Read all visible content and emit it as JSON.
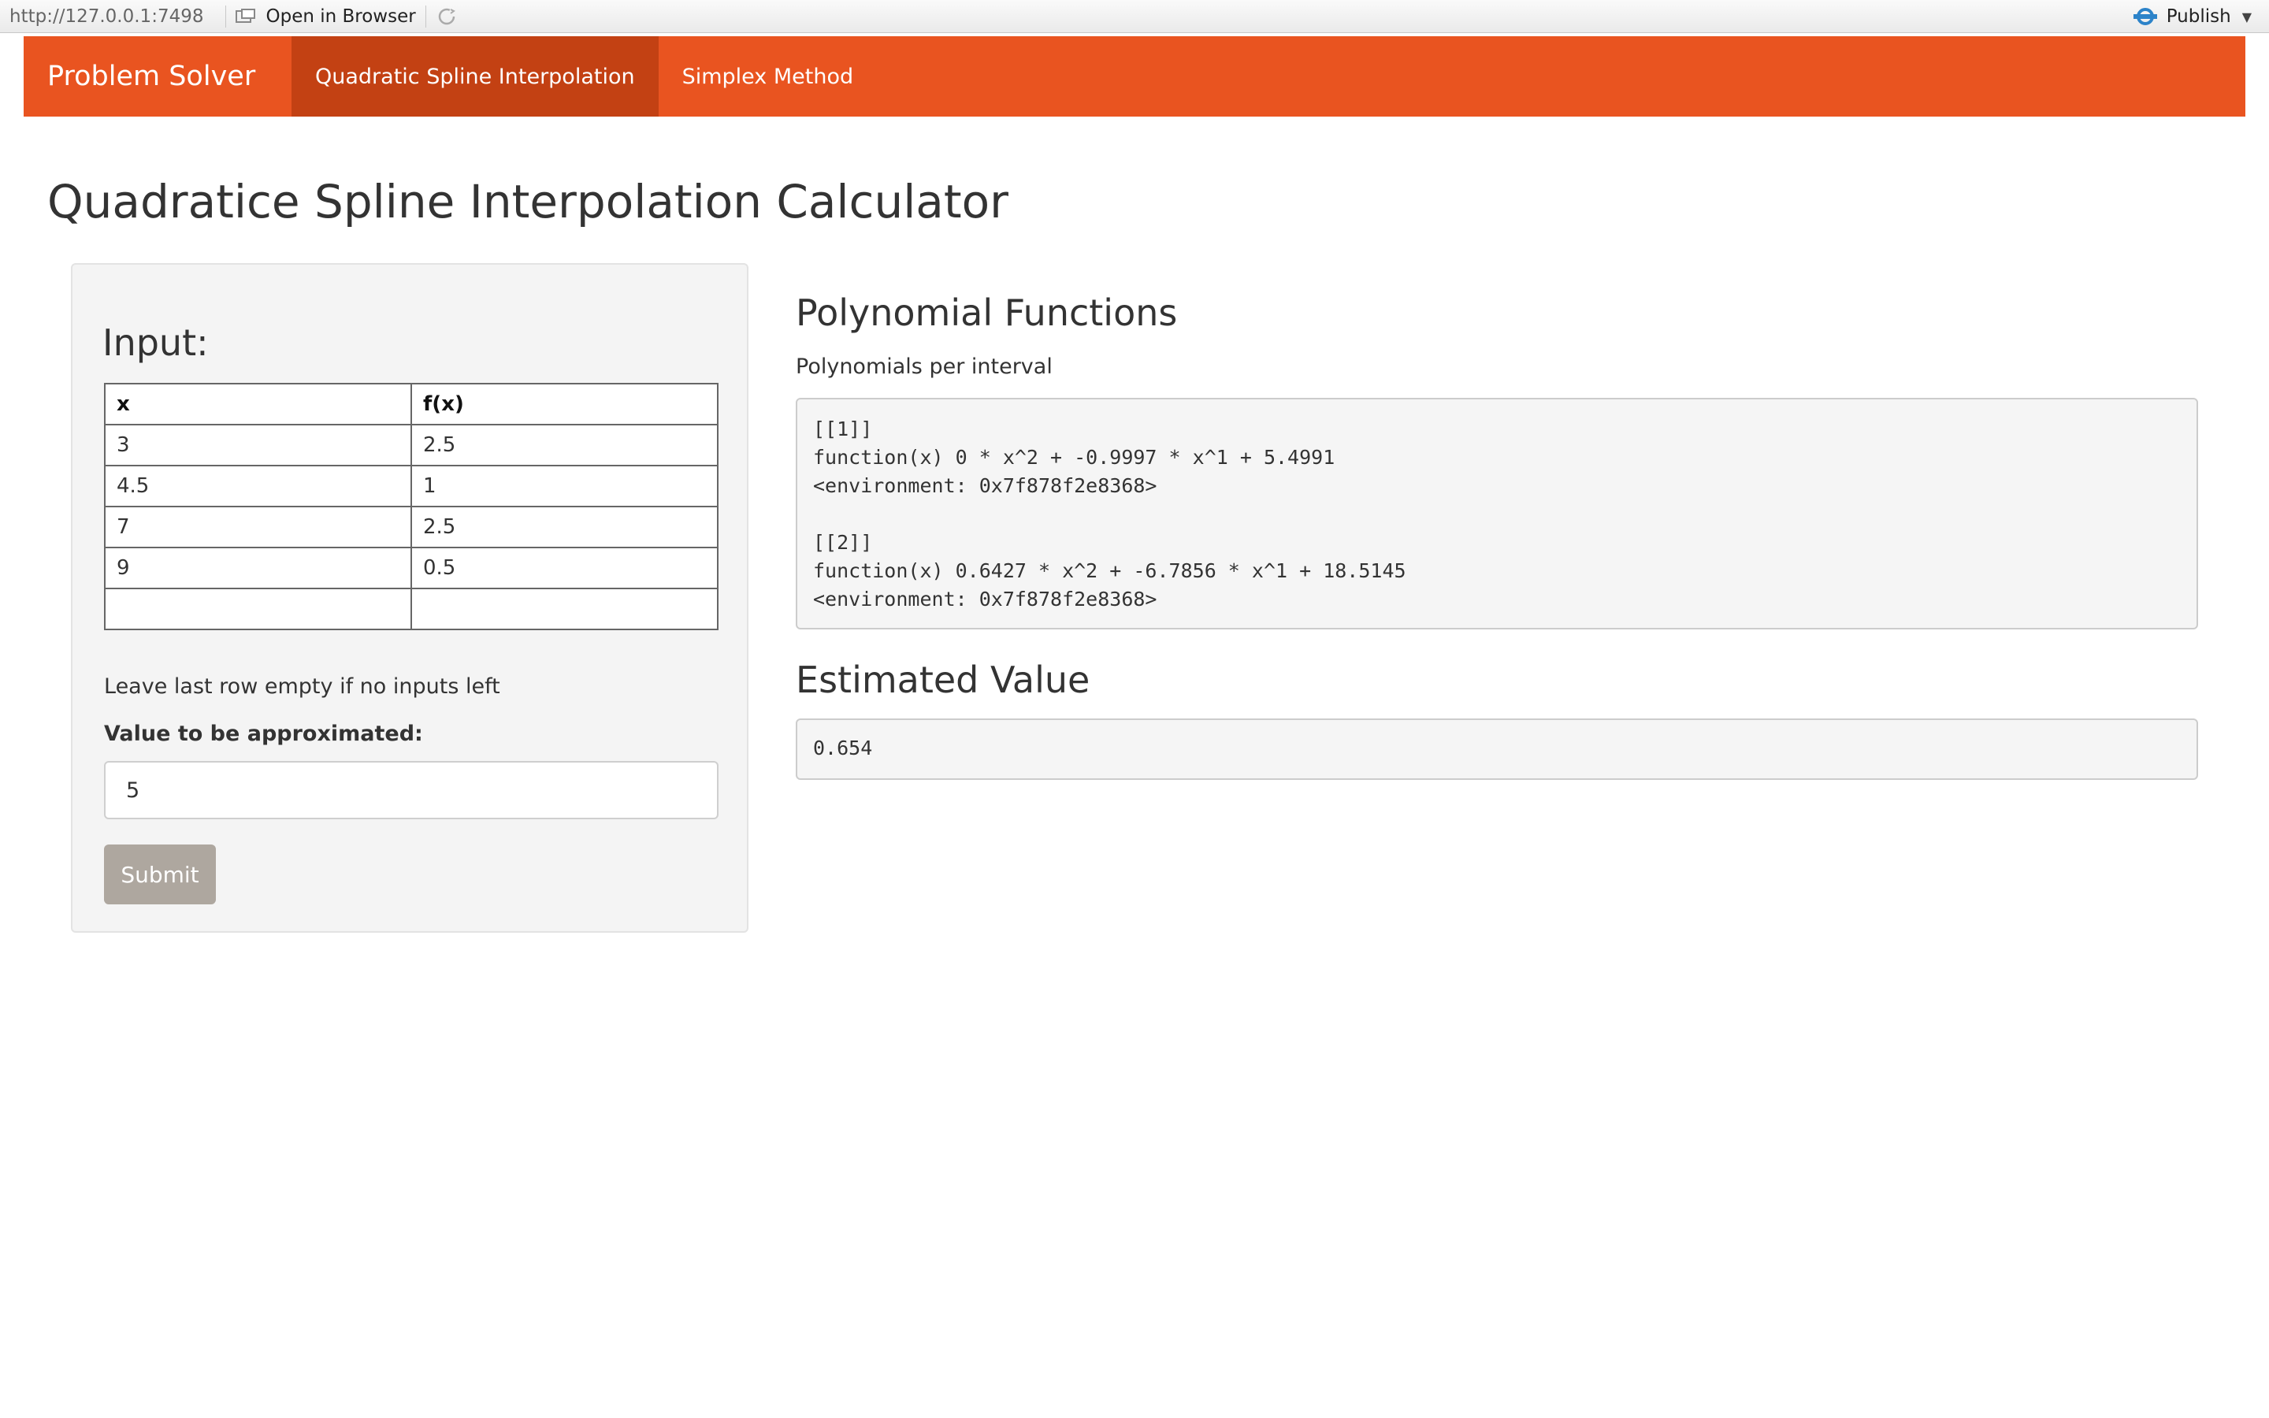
{
  "viewer": {
    "url": "http://127.0.0.1:7498",
    "open_browser_label": "Open in Browser",
    "publish_label": "Publish"
  },
  "navbar": {
    "brand": "Problem Solver",
    "tabs": [
      {
        "label": "Quadratic Spline Interpolation",
        "active": true
      },
      {
        "label": "Simplex Method",
        "active": false
      }
    ]
  },
  "page_title": "Quadratice Spline Interpolation Calculator",
  "input_panel": {
    "heading": "Input:",
    "table": {
      "headers": [
        "x",
        "f(x)"
      ],
      "rows": [
        [
          "3",
          "2.5"
        ],
        [
          "4.5",
          "1"
        ],
        [
          "7",
          "2.5"
        ],
        [
          "9",
          "0.5"
        ],
        [
          "",
          ""
        ]
      ]
    },
    "note": "Leave last row empty if no inputs left",
    "value_label": "Value to be approximated:",
    "value": "5",
    "submit_label": "Submit"
  },
  "results": {
    "polynomial_heading": "Polynomial Functions",
    "polynomial_subtitle": "Polynomials per interval",
    "polynomial_output": "[[1]]\nfunction(x) 0 * x^2 + -0.9997 * x^1 + 5.4991\n<environment: 0x7f878f2e8368>\n\n[[2]]\nfunction(x) 0.6427 * x^2 + -6.7856 * x^1 + 18.5145\n<environment: 0x7f878f2e8368>",
    "estimate_heading": "Estimated Value",
    "estimate_output": "0.654"
  },
  "colors": {
    "navbar": "#e95420",
    "navbar_active": "#c34113",
    "submit_button": "#aea79f"
  }
}
